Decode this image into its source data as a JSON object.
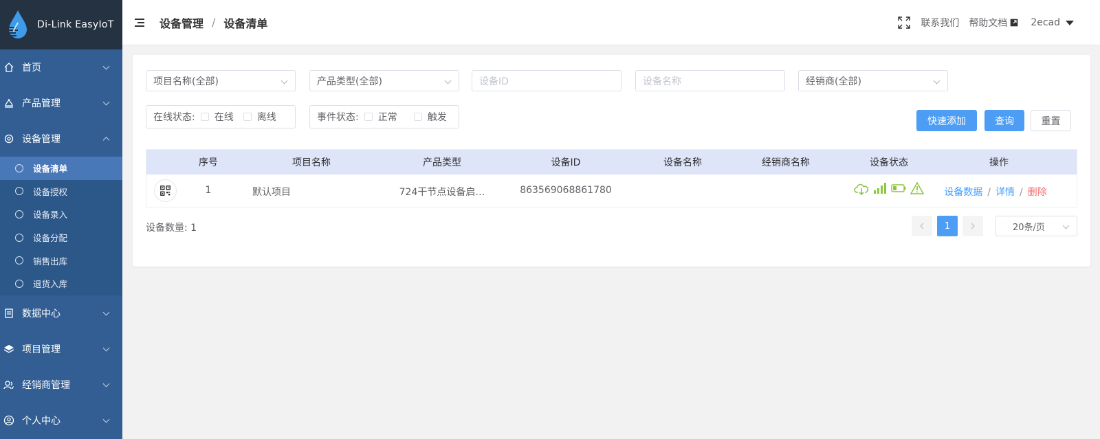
{
  "brand": {
    "name": "Di-Link EasyIoT"
  },
  "sidebar": {
    "items": [
      {
        "label": "首页"
      },
      {
        "label": "产品管理"
      },
      {
        "label": "设备管理"
      },
      {
        "label": "数据中心"
      },
      {
        "label": "项目管理"
      },
      {
        "label": "经销商管理"
      },
      {
        "label": "个人中心"
      }
    ],
    "subitems": [
      {
        "label": "设备清单"
      },
      {
        "label": "设备授权"
      },
      {
        "label": "设备录入"
      },
      {
        "label": "设备分配"
      },
      {
        "label": "销售出库"
      },
      {
        "label": "退货入库"
      }
    ]
  },
  "header": {
    "breadcrumb": [
      "设备管理",
      "设备清单"
    ],
    "breadcrumb_sep": "/",
    "contact": "联系我们",
    "help": "帮助文档",
    "user": "2ecad"
  },
  "filters": {
    "project": "项目名称(全部)",
    "product_type": "产品类型(全部)",
    "device_id_placeholder": "设备ID",
    "device_name_placeholder": "设备名称",
    "dealer": "经销商(全部)",
    "online_label": "在线状态:",
    "online": "在线",
    "offline": "离线",
    "event_label": "事件状态:",
    "normal": "正常",
    "trigger": "触发"
  },
  "buttons": {
    "quick_add": "快速添加",
    "query": "查询",
    "reset": "重置"
  },
  "table": {
    "columns": [
      "序号",
      "项目名称",
      "产品类型",
      "设备ID",
      "设备名称",
      "经销商名称",
      "设备状态",
      "操作"
    ],
    "rows": [
      {
        "index": "1",
        "project": "默认项目",
        "product_type": "724干节点设备启…",
        "device_id": "863569068861780",
        "device_name": "",
        "dealer": "",
        "op_data": "设备数据",
        "op_detail": "详情",
        "op_delete": "删除"
      }
    ],
    "op_sep": "/"
  },
  "footer": {
    "count": "设备数量: 1",
    "page": "1",
    "page_size": "20条/页"
  },
  "colors": {
    "sidebar": "#325e93",
    "brand_bar": "#253242",
    "primary": "#4d9df5",
    "status_green": "#8cc63f",
    "danger": "#f56c6c"
  }
}
